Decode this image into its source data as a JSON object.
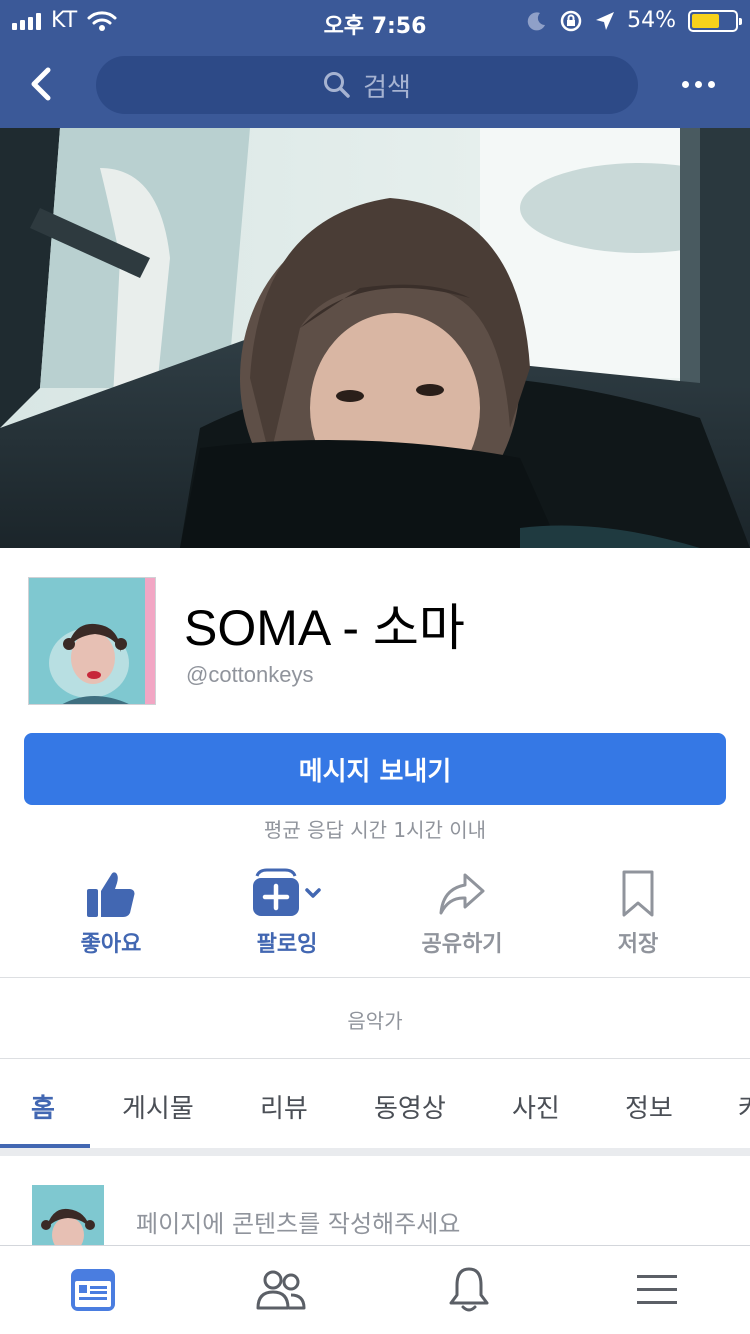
{
  "status_bar": {
    "carrier": "KT",
    "time": "오후 7:56",
    "battery_percent": "54%"
  },
  "nav": {
    "search_placeholder": "검색"
  },
  "page": {
    "name": "SOMA - 소마",
    "handle": "@cottonkeys",
    "message_button": "메시지 보내기",
    "response_time": "평균 응답 시간 1시간 이내",
    "category": "음악가"
  },
  "actions": [
    {
      "label": "좋아요",
      "icon": "thumbs-up-icon",
      "active": true
    },
    {
      "label": "팔로잉",
      "icon": "following-icon",
      "active": true
    },
    {
      "label": "공유하기",
      "icon": "share-icon",
      "active": false
    },
    {
      "label": "저장",
      "icon": "bookmark-icon",
      "active": false
    }
  ],
  "tabs": [
    {
      "label": "홈",
      "active": true
    },
    {
      "label": "게시물"
    },
    {
      "label": "리뷰"
    },
    {
      "label": "동영상"
    },
    {
      "label": "사진"
    },
    {
      "label": "정보"
    },
    {
      "label": "커"
    }
  ],
  "composer": {
    "placeholder": "페이지에 콘텐츠를 작성해주세요"
  },
  "bottom_nav": [
    "news-feed-icon",
    "friends-icon",
    "notifications-icon",
    "menu-icon"
  ],
  "colors": {
    "brand": "#3b5998",
    "button": "#3578e5",
    "active": "#4267b2",
    "inactive": "#90949c"
  }
}
